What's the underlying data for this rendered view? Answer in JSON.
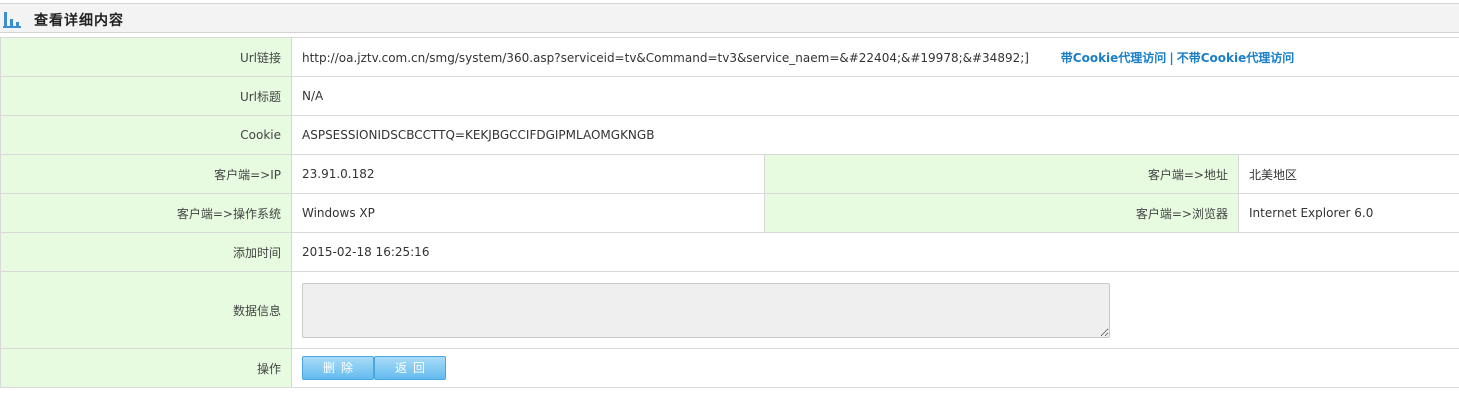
{
  "header": {
    "title": "查看详细内容",
    "icon": "bar-chart-icon"
  },
  "rows": {
    "url": {
      "label": "Url链接",
      "value": "http://oa.jztv.com.cn/smg/system/360.asp?serviceid=tv&Command=tv3&service_naem=&#22404;&#19978;&#34892;]",
      "link_with_cookie": "带Cookie代理访问",
      "separator": "|",
      "link_without_cookie": "不带Cookie代理访问"
    },
    "url_title": {
      "label": "Url标题",
      "value": "N/A"
    },
    "cookie": {
      "label": "Cookie",
      "value": "ASPSESSIONIDSCBCCTTQ=KEKJBGCCIFDGIPMLAOMGKNGB"
    },
    "client_ip": {
      "label": "客户端=>IP",
      "value": "23.91.0.182"
    },
    "client_address": {
      "label": "客户端=>地址",
      "value": "北美地区"
    },
    "client_os": {
      "label": "客户端=>操作系统",
      "value": "Windows XP"
    },
    "client_browser": {
      "label": "客户端=>浏览器",
      "value": "Internet Explorer 6.0"
    },
    "added_time": {
      "label": "添加时间",
      "value": "2015-02-18 16:25:16"
    },
    "data_info": {
      "label": "数据信息",
      "value": ""
    },
    "actions": {
      "label": "操作",
      "delete_label": "删除",
      "back_label": "返回"
    }
  },
  "colors": {
    "label_bg": "#e6fbe0",
    "link": "#1a7fc8",
    "button": "#63bbee",
    "border": "#d9d9d9"
  }
}
